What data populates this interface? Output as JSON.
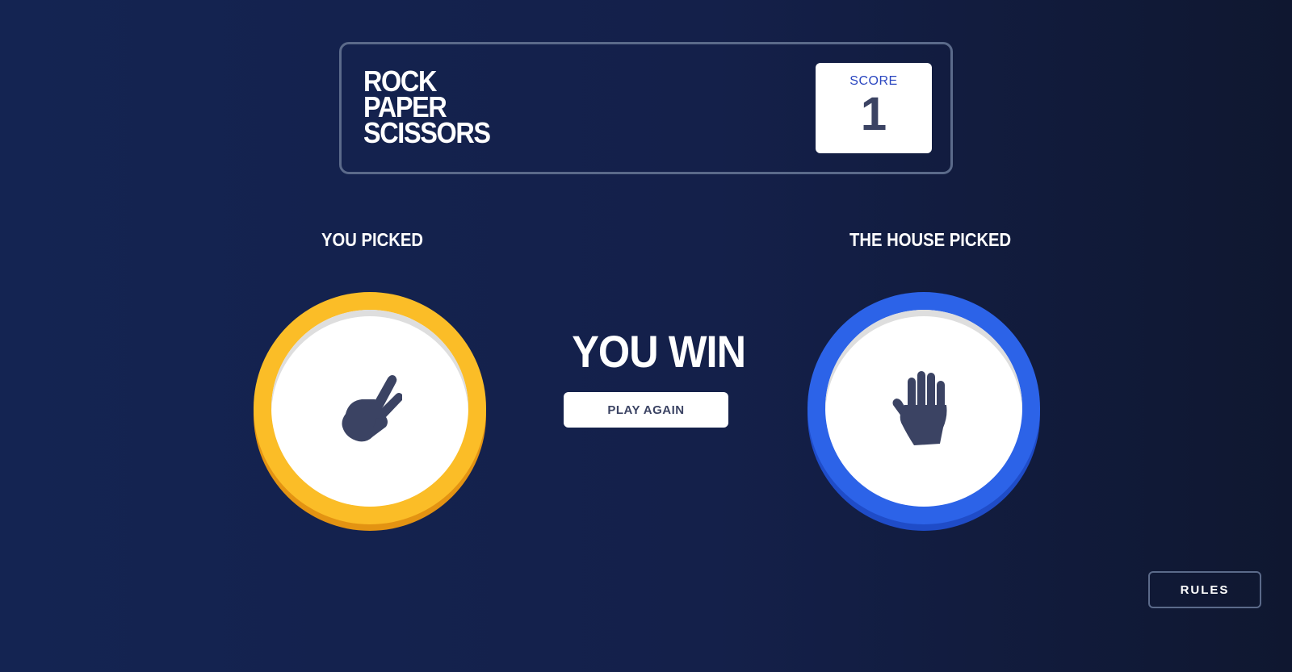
{
  "header": {
    "title_lines": [
      "ROCK",
      "PAPER",
      "SCISSORS"
    ],
    "score_label": "SCORE",
    "score_value": "1"
  },
  "you": {
    "label": "YOU PICKED",
    "choice": "scissors",
    "choice_icon": "scissors-hand-icon",
    "ring_color": "#fbbd27"
  },
  "house": {
    "label": "THE HOUSE PICKED",
    "choice": "paper",
    "choice_icon": "paper-hand-icon",
    "ring_color": "#2c63e8"
  },
  "result": {
    "text": "YOU WIN",
    "play_again_label": "PLAY AGAIN"
  },
  "rules_label": "RULES"
}
